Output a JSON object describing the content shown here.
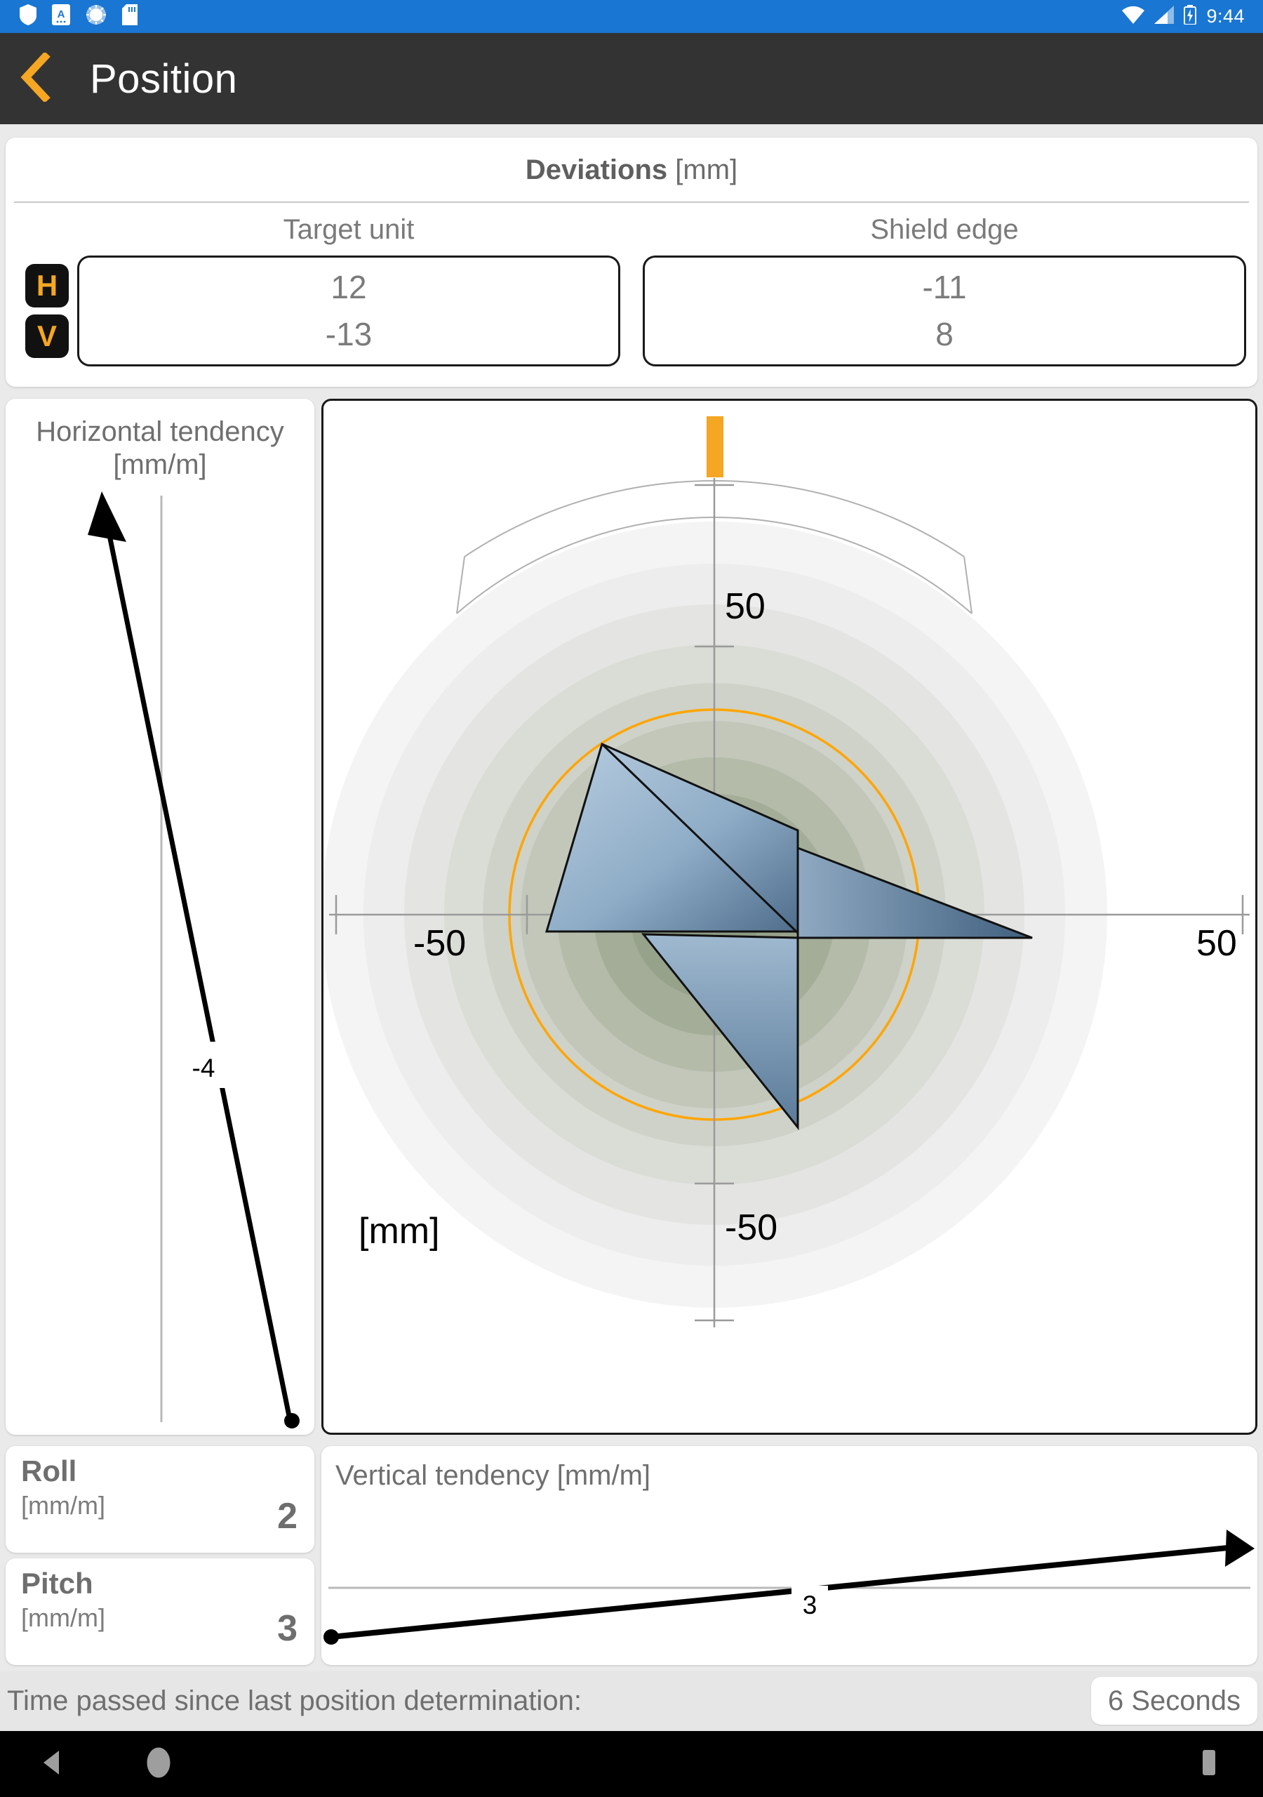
{
  "statusbar": {
    "clock": "9:44",
    "left_icons": [
      "shield-icon",
      "keyboard-language-icon",
      "sync-progress-icon",
      "sd-card-icon"
    ],
    "right_icons": [
      "wifi-icon",
      "cellular-signal-icon",
      "battery-charging-icon"
    ]
  },
  "titlebar": {
    "back_icon": "chevron-left-icon",
    "title": "Position",
    "accent": "#f5a623"
  },
  "deviations": {
    "title_bold": "Deviations",
    "title_unit": " [mm]",
    "target_unit_label": "Target unit",
    "shield_edge_label": "Shield edge",
    "badge_h": "H",
    "badge_v": "V",
    "target_unit_h": "12",
    "target_unit_v": "-13",
    "shield_edge_h": "-11",
    "shield_edge_v": "8"
  },
  "horizontal_tendency": {
    "title": "Horizontal tendency [mm/m]",
    "value_label": "-4"
  },
  "vertical_tendency": {
    "title": "Vertical tendency [mm/m]",
    "value_label": "3"
  },
  "position_chart": {
    "unit_label": "[mm]",
    "axis_left": "-50",
    "axis_right": "50",
    "axis_top": "50",
    "axis_bottom": "-50",
    "tolerance_ring_color": "#ffa500",
    "gauge_indicator_color": "#f5a623"
  },
  "roll": {
    "name": "Roll",
    "unit": "[mm/m]",
    "value": "2"
  },
  "pitch": {
    "name": "Pitch",
    "unit": "[mm/m]",
    "value": "3"
  },
  "footer": {
    "text": "Time passed since last position determination:",
    "elapsed": "6 Seconds"
  },
  "navbar": {
    "back_icon": "nav-back-icon",
    "home_icon": "nav-home-icon",
    "recents_icon": "nav-recents-icon"
  },
  "chart_data": {
    "type": "scatter",
    "title": "Position deviation target view",
    "xlabel": "[mm]",
    "ylabel": "[mm]",
    "xlim": [
      -75,
      75
    ],
    "ylim": [
      -75,
      75
    ],
    "xticks": [
      -50,
      0,
      50
    ],
    "yticks": [
      -50,
      0,
      50
    ],
    "grid": false,
    "tolerance_circle_radius": 30,
    "rings": [
      {
        "radius": 70,
        "color": "#efefef"
      },
      {
        "radius": 62,
        "color": "#e3e4e2"
      },
      {
        "radius": 54,
        "color": "#d6d8d2"
      },
      {
        "radius": 46,
        "color": "#c9ccc3"
      },
      {
        "radius": 38,
        "color": "#bcc0b4"
      },
      {
        "radius": 30,
        "color": "#aeb4a3"
      },
      {
        "radius": 22,
        "color": "#9ea795"
      },
      {
        "radius": 14,
        "color": "#8e9a84"
      }
    ],
    "series": [
      {
        "name": "Target unit",
        "values": [
          12,
          -13
        ]
      },
      {
        "name": "Shield edge",
        "values": [
          -11,
          8
        ]
      }
    ],
    "gauge": {
      "value": 0,
      "min": -50,
      "max": 50,
      "label": "roll-gauge"
    },
    "annotations": [
      "50",
      "-50",
      "[mm]"
    ]
  }
}
